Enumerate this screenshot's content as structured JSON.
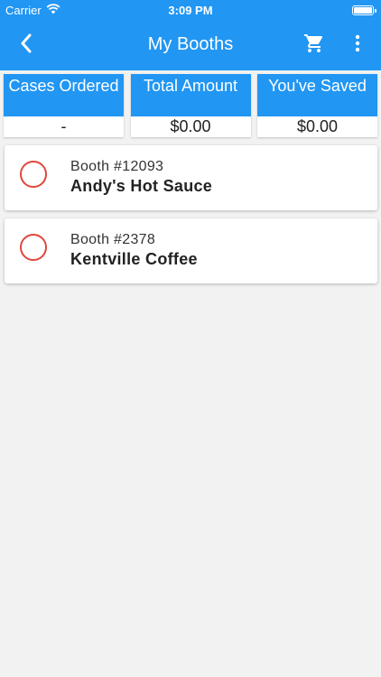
{
  "status_bar": {
    "carrier": "Carrier",
    "time": "3:09 PM"
  },
  "header": {
    "title": "My Booths"
  },
  "stats": [
    {
      "label": "Cases Ordered",
      "value": "-"
    },
    {
      "label": "Total Amount",
      "value": "$0.00"
    },
    {
      "label": "You've Saved",
      "value": "$0.00"
    }
  ],
  "booths": [
    {
      "number": "Booth #12093",
      "name": "Andy's Hot Sauce"
    },
    {
      "number": "Booth #2378",
      "name": "Kentville Coffee"
    }
  ],
  "colors": {
    "primary": "#2196f3",
    "radio": "#e0473c",
    "background": "#f2f2f2"
  },
  "icons": [
    "back-icon",
    "cart-icon",
    "more-vert-icon",
    "wifi-icon",
    "battery-icon"
  ]
}
